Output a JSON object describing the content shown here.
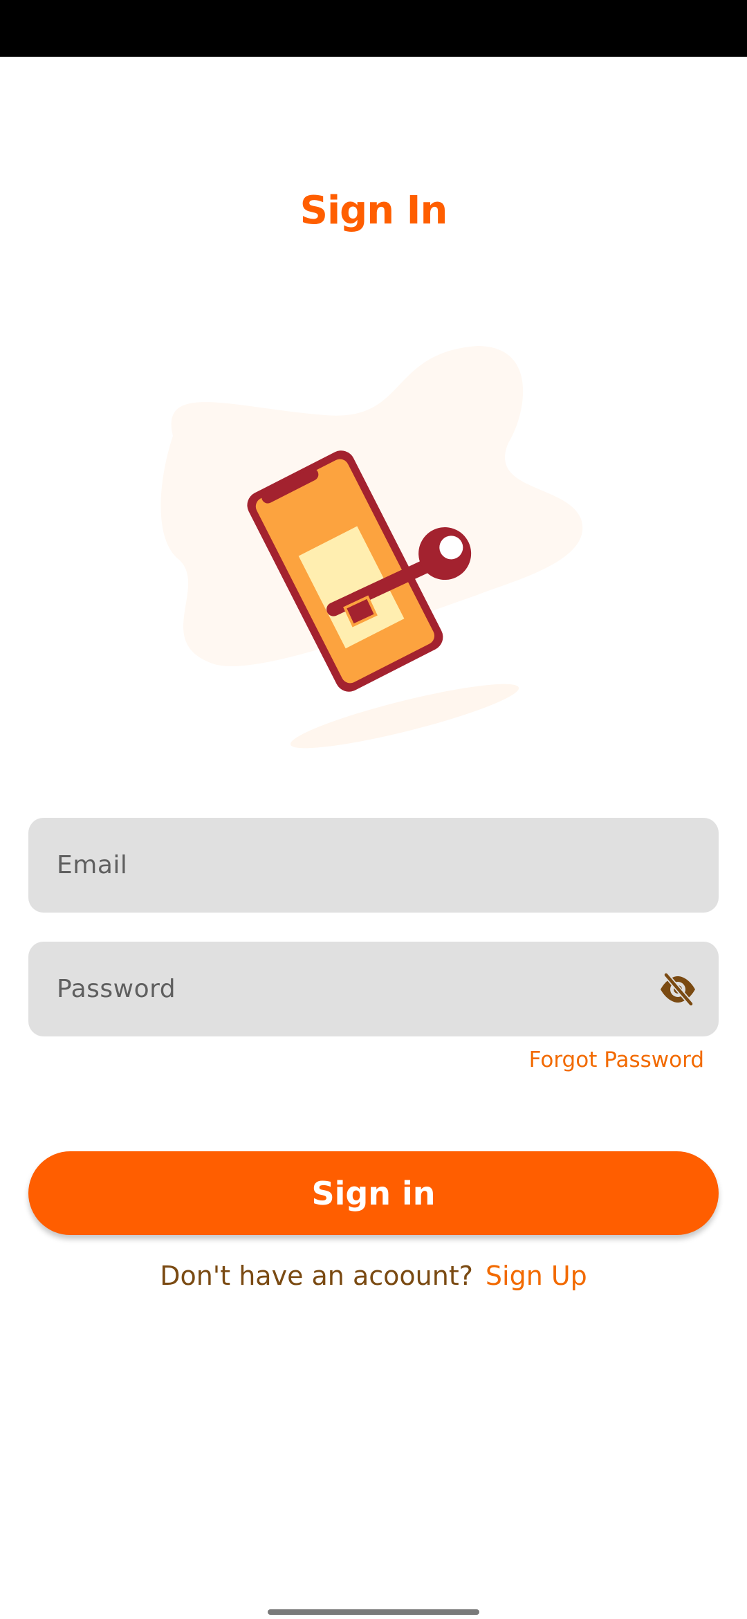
{
  "colors": {
    "accent": "#ff5e00",
    "accent_text": "#f26a00",
    "brown_text": "#7a4a12",
    "field_bg": "#e0e0e0",
    "placeholder": "#5f5f5f",
    "icon_brown": "#7a4a12"
  },
  "page": {
    "title": "Sign In"
  },
  "form": {
    "email_placeholder": "Email",
    "password_placeholder": "Password",
    "password_toggle_icon": "eye-off-icon",
    "forgot_password": "Forgot Password",
    "submit_label": "Sign in"
  },
  "signup": {
    "prompt": "Don't have an acoount?",
    "link": "Sign Up"
  },
  "illustration": {
    "icon": "phone-with-key-illustration"
  }
}
